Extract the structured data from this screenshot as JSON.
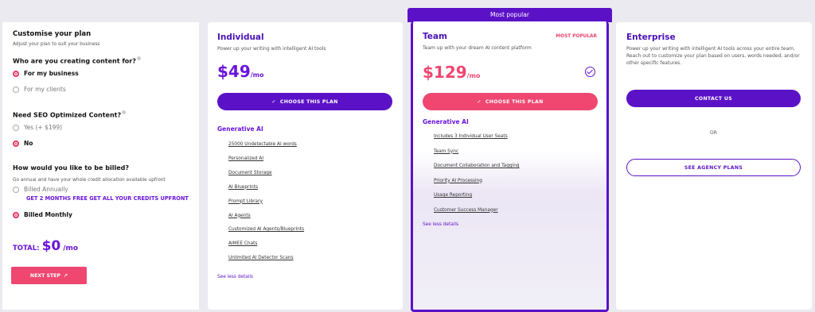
{
  "customise": {
    "title": "Customise your plan",
    "subtitle": "Adjust your plan to suit your business",
    "q1": "Who are you creating content for?",
    "q1_options": [
      "For my business",
      "For my clients"
    ],
    "q2": "Need SEO Optimized Content?",
    "q2_options": [
      "Yes (+ $199)",
      "No"
    ],
    "q3": "How would you like to be billed?",
    "q3_sub": "Go annual and have your whole credit allocation available upfront",
    "q3_options": [
      "Billed Annually",
      "Billed Monthly"
    ],
    "promo": "GET 2 MONTHS FREE GET ALL YOUR CREDITS UPFRONT",
    "total_label": "TOTAL:",
    "total_amount": "$0",
    "total_unit": "/mo",
    "next_label": "NEXT STEP"
  },
  "popular_banner": "Most popular",
  "individual": {
    "title": "Individual",
    "subtitle": "Power up your writing with intelligent AI tools",
    "price": "$49",
    "per": "/mo",
    "button": "CHOOSE THIS PLAN",
    "section": "Generative AI",
    "features": [
      "25000 Undetectable AI words",
      "Personalized AI",
      "Document Storage",
      "AI Blueprints",
      "Prompt Library",
      "AI Agents",
      "Customized AI Agents/Blueprints",
      "AIMEE Chats",
      "Unlimited AI Detector Scans"
    ],
    "see_less": "See less details"
  },
  "team": {
    "title": "Team",
    "tag": "MOST POPULAR",
    "subtitle": "Team up with your dream AI content platform",
    "price": "$129",
    "per": "/mo",
    "button": "CHOOSE THIS PLAN",
    "section": "Generative AI",
    "features": [
      "Includes 3 Individual User Seats",
      "Team Sync",
      "Document Collaboration and Tagging",
      "Priority AI Processing",
      "Usage Reporting",
      "Customer Success Manager"
    ],
    "see_less": "See less details"
  },
  "enterprise": {
    "title": "Enterprise",
    "subtitle": "Power up your writing with intelligent AI tools across your entire team. Reach out to customize your plan based on users, words needed, and/or other specific features.",
    "contact": "CONTACT US",
    "or": "OR",
    "agency": "SEE AGENCY PLANS"
  },
  "colors": {
    "purple": "#5b12c7",
    "pink": "#ef4770",
    "violet_text": "#6a15d9"
  }
}
